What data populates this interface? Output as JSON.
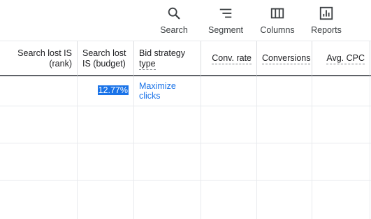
{
  "toolbar": {
    "items": [
      {
        "label": "Search",
        "icon": "search-icon"
      },
      {
        "label": "Segment",
        "icon": "segment-icon"
      },
      {
        "label": "Columns",
        "icon": "columns-icon"
      },
      {
        "label": "Reports",
        "icon": "reports-icon"
      }
    ]
  },
  "table": {
    "headers": [
      {
        "line1": "Search lost IS",
        "line2": "(rank)"
      },
      {
        "line1": "Search lost",
        "line2": "IS (budget)"
      },
      {
        "line1": "Bid strategy",
        "line2": "type"
      },
      {
        "line1": "Conv. rate",
        "line2": ""
      },
      {
        "line1": "Conversions",
        "line2": ""
      },
      {
        "line1": "Avg. CPC",
        "line2": ""
      }
    ],
    "rows": [
      {
        "search_lost_is_budget": "12.77%",
        "bid_strategy_line1": "Maximize",
        "bid_strategy_line2": "clicks"
      }
    ]
  },
  "colors": {
    "accent": "#1a73e8",
    "header_rule": "#5f6368",
    "grid_line": "#e8eaed"
  }
}
